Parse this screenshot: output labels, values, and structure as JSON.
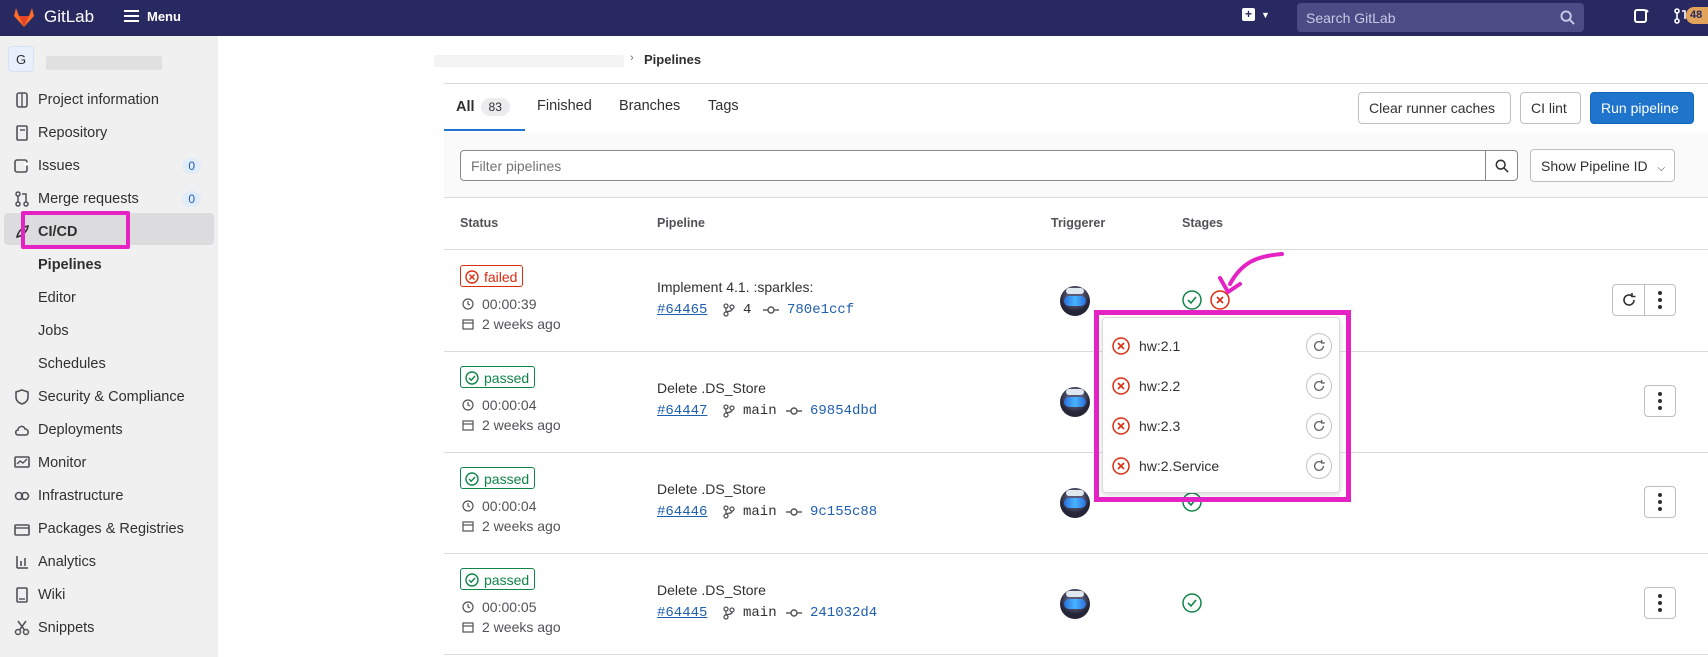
{
  "topbar": {
    "brand": "GitLab",
    "menu_label": "Menu",
    "search_placeholder": "Search GitLab",
    "badge_count": "48",
    "background": "#292961"
  },
  "sidebar": {
    "project_initial": "G",
    "items": [
      {
        "label": "Project information",
        "icon": "doc-icon"
      },
      {
        "label": "Repository",
        "icon": "book-icon"
      },
      {
        "label": "Issues",
        "icon": "issues-icon",
        "count": "0"
      },
      {
        "label": "Merge requests",
        "icon": "merge-request-icon",
        "count": "0"
      },
      {
        "label": "CI/CD",
        "icon": "rocket-icon"
      },
      {
        "label": "Pipelines"
      },
      {
        "label": "Editor"
      },
      {
        "label": "Jobs"
      },
      {
        "label": "Schedules"
      },
      {
        "label": "Security & Compliance",
        "icon": "shield-icon"
      },
      {
        "label": "Deployments",
        "icon": "cloud-icon"
      },
      {
        "label": "Monitor",
        "icon": "monitor-icon"
      },
      {
        "label": "Infrastructure",
        "icon": "infra-icon"
      },
      {
        "label": "Packages & Registries",
        "icon": "package-icon"
      },
      {
        "label": "Analytics",
        "icon": "chart-icon"
      },
      {
        "label": "Wiki",
        "icon": "wiki-icon"
      },
      {
        "label": "Snippets",
        "icon": "snippet-icon"
      }
    ]
  },
  "breadcrumb": {
    "current": "Pipelines"
  },
  "tabs": [
    {
      "label": "All",
      "count": "83"
    },
    {
      "label": "Finished"
    },
    {
      "label": "Branches"
    },
    {
      "label": "Tags"
    }
  ],
  "actions": {
    "clear_cache": "Clear runner caches",
    "ci_lint": "CI lint",
    "run_pipeline": "Run pipeline"
  },
  "filter": {
    "placeholder": "Filter pipelines",
    "dropdown": "Show Pipeline ID"
  },
  "columns": [
    "Status",
    "Pipeline",
    "Triggerer",
    "Stages"
  ],
  "pipelines": [
    {
      "status": "failed",
      "duration": "00:00:39",
      "finished": "2 weeks ago",
      "title": "Implement 4.1. :sparkles:",
      "id": "#64465",
      "ref": "4",
      "sha": "780e1ccf"
    },
    {
      "status": "passed",
      "duration": "00:00:04",
      "finished": "2 weeks ago",
      "title": "Delete .DS_Store",
      "id": "#64447",
      "ref": "main",
      "sha": "69854dbd"
    },
    {
      "status": "passed",
      "duration": "00:00:04",
      "finished": "2 weeks ago",
      "title": "Delete .DS_Store",
      "id": "#64446",
      "ref": "main",
      "sha": "9c155c88"
    },
    {
      "status": "passed",
      "duration": "00:00:05",
      "finished": "2 weeks ago",
      "title": "Delete .DS_Store",
      "id": "#64445",
      "ref": "main",
      "sha": "241032d4"
    }
  ],
  "stage_jobs": [
    {
      "name": "hw:2.1"
    },
    {
      "name": "hw:2.2"
    },
    {
      "name": "hw:2.3"
    },
    {
      "name": "hw:2.Service"
    }
  ],
  "colors": {
    "failed": "#dd2b0e",
    "passed": "#108548",
    "highlight": "#e523c5",
    "primary": "#1f75cb"
  }
}
